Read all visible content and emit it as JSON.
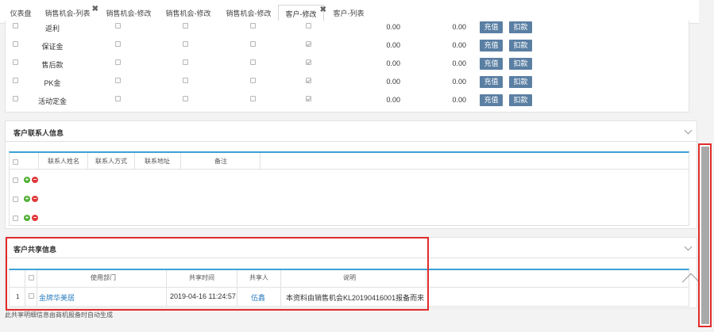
{
  "tabs": [
    {
      "label": "仪表盘",
      "closable": false
    },
    {
      "label": "销售机会-列表",
      "closable": true
    },
    {
      "label": "销售机会-修改",
      "closable": false
    },
    {
      "label": "销售机会-修改",
      "closable": false
    },
    {
      "label": "销售机会-修改",
      "closable": false
    },
    {
      "label": "客户-修改",
      "closable": true,
      "active": true
    },
    {
      "label": "客户-列表",
      "closable": false
    }
  ],
  "close_glyph": "✖",
  "accounts": [
    {
      "name": "返利",
      "amount1": "0.00",
      "amount2": "0.00",
      "checked": false
    },
    {
      "name": "保证金",
      "amount1": "0.00",
      "amount2": "0.00",
      "checked": true
    },
    {
      "name": "售后款",
      "amount1": "0.00",
      "amount2": "0.00",
      "checked": true
    },
    {
      "name": "PK金",
      "amount1": "0.00",
      "amount2": "0.00",
      "checked": true
    },
    {
      "name": "活动定金",
      "amount1": "0.00",
      "amount2": "0.00",
      "checked": true
    }
  ],
  "buttons": {
    "recharge": "充值",
    "deduct": "扣款"
  },
  "contacts": {
    "title": "客户联系人信息",
    "headers": [
      "联系人姓名",
      "联系人方式",
      "联系地址",
      "备注"
    ],
    "row_count": 3
  },
  "share": {
    "title": "客户共享信息",
    "headers": [
      "使用部门",
      "共享时间",
      "共享人",
      "说明"
    ],
    "rows": [
      {
        "index": "1",
        "dept": "金牌华美居",
        "time": "2019-04-16 11:24:57",
        "user": "伍鑫",
        "desc": "本资料由销售机会KL20190416001报备而来"
      }
    ],
    "footnote": "此共享明细信息由商机报备时自动生成"
  },
  "colors": {
    "accent": "#3aa2d6",
    "button": "#5a7fa3",
    "highlight": "#e22b2b",
    "link": "#2f7fc1"
  }
}
